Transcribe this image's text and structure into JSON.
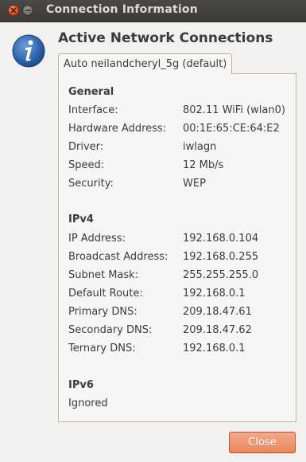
{
  "window": {
    "title": "Connection Information"
  },
  "heading": "Active Network Connections",
  "tab": {
    "label": "Auto neilandcheryl_5g (default)"
  },
  "general": {
    "title": "General",
    "rows": [
      {
        "label": "Interface:",
        "value": "802.11 WiFi (wlan0)"
      },
      {
        "label": "Hardware Address:",
        "value": "00:1E:65:CE:64:E2"
      },
      {
        "label": "Driver:",
        "value": "iwlagn"
      },
      {
        "label": "Speed:",
        "value": "12 Mb/s"
      },
      {
        "label": "Security:",
        "value": "WEP"
      }
    ]
  },
  "ipv4": {
    "title": "IPv4",
    "rows": [
      {
        "label": "IP Address:",
        "value": "192.168.0.104"
      },
      {
        "label": "Broadcast Address:",
        "value": "192.168.0.255"
      },
      {
        "label": "Subnet Mask:",
        "value": "255.255.255.0"
      },
      {
        "label": "Default Route:",
        "value": "192.168.0.1"
      },
      {
        "label": "Primary DNS:",
        "value": "209.18.47.61"
      },
      {
        "label": "Secondary DNS:",
        "value": "209.18.47.62"
      },
      {
        "label": "Ternary DNS:",
        "value": "192.168.0.1"
      }
    ]
  },
  "ipv6": {
    "title": "IPv6",
    "value": "Ignored"
  },
  "buttons": {
    "close": "Close"
  },
  "colors": {
    "titlebar": "#3c3b37",
    "accent": "#ea8860",
    "close_circle": "#e2561e"
  }
}
